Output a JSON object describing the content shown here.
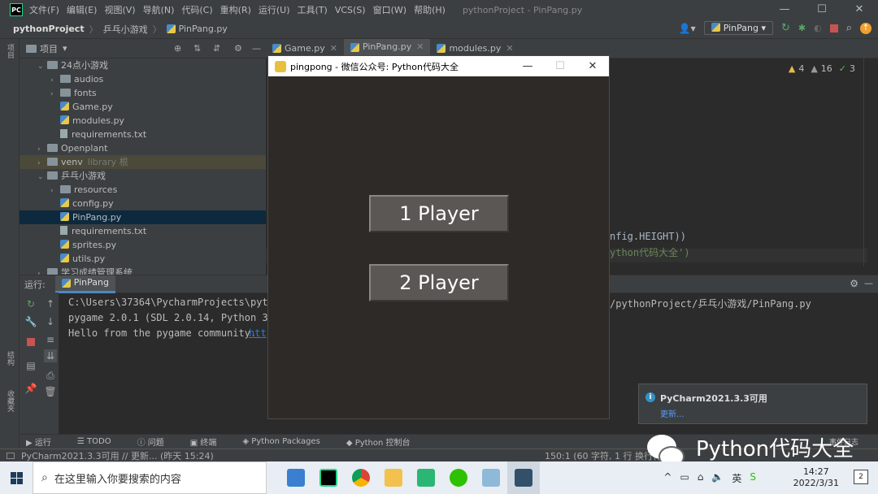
{
  "ide": {
    "menu": [
      "文件(F)",
      "编辑(E)",
      "视图(V)",
      "导航(N)",
      "代码(C)",
      "重构(R)",
      "运行(U)",
      "工具(T)",
      "VCS(S)",
      "窗口(W)",
      "帮助(H)"
    ],
    "window_title": "pythonProject - PinPang.py",
    "breadcrumb": [
      "pythonProject",
      "乒乓小游戏",
      "PinPang.py"
    ],
    "run_config": "PinPang",
    "project_panel_title": "项目",
    "tree": [
      {
        "label": "24点小游戏",
        "kind": "folder",
        "depth": 1,
        "open": true
      },
      {
        "label": "audios",
        "kind": "folder",
        "depth": 2,
        "open": false
      },
      {
        "label": "fonts",
        "kind": "folder",
        "depth": 2,
        "open": false
      },
      {
        "label": "Game.py",
        "kind": "py",
        "depth": 2
      },
      {
        "label": "modules.py",
        "kind": "py",
        "depth": 2
      },
      {
        "label": "requirements.txt",
        "kind": "txt",
        "depth": 2
      },
      {
        "label": "Openplant",
        "kind": "folder",
        "depth": 1,
        "open": false
      },
      {
        "label": "venv",
        "kind": "folder",
        "depth": 1,
        "open": false,
        "suffix": "library 根"
      },
      {
        "label": "乒乓小游戏",
        "kind": "folder",
        "depth": 1,
        "open": true
      },
      {
        "label": "resources",
        "kind": "folder",
        "depth": 2,
        "open": false
      },
      {
        "label": "config.py",
        "kind": "py",
        "depth": 2
      },
      {
        "label": "PinPang.py",
        "kind": "py",
        "depth": 2,
        "selected": true
      },
      {
        "label": "requirements.txt",
        "kind": "txt",
        "depth": 2
      },
      {
        "label": "sprites.py",
        "kind": "py",
        "depth": 2
      },
      {
        "label": "utils.py",
        "kind": "py",
        "depth": 2
      },
      {
        "label": "学习成绩管理系统",
        "kind": "folder",
        "depth": 1,
        "open": false
      }
    ],
    "editor_tabs": [
      {
        "label": "Game.py",
        "active": false
      },
      {
        "label": "PinPang.py",
        "active": true
      },
      {
        "label": "modules.py",
        "active": false
      }
    ],
    "inspections": {
      "warnings": "4",
      "weak": "16",
      "ok": "3"
    },
    "code_fragments": [
      "nfig.HEIGHT))",
      "ython代码大全')"
    ],
    "run_label": "运行:",
    "run_tab": "PinPang",
    "console": {
      "line1": "C:\\Users\\37364\\PycharmProjects\\pytho",
      "line1_tail": "/pythonProject/乒乓小游戏/PinPang.py",
      "line2": "pygame 2.0.1 (SDL 2.0.14, Python 3.8",
      "line3": "Hello from the pygame community. ",
      "line3_link": "htt"
    },
    "bottom_tabs": [
      "运行",
      "TODO",
      "问题",
      "终端",
      "Python Packages",
      "Python 控制台"
    ],
    "event_log": "事件日志",
    "status_left": "PyCharm2021.3.3可用 // 更新... (昨天 15:24)",
    "status_right": "150:1 (60 字符, 1 行 换行符)",
    "left_strip_labels": [
      "项目",
      "结构",
      "收藏夹"
    ],
    "notification": {
      "title": "PyCharm2021.3.3可用",
      "link": "更新..."
    }
  },
  "pygame_window": {
    "title": "pingpong - 微信公众号: Python代码大全",
    "buttons": [
      "1 Player",
      "2 Player"
    ]
  },
  "watermark": "Python代码大全",
  "taskbar": {
    "search_placeholder": "在这里输入你要搜索的内容",
    "time": "14:27",
    "date": "2022/3/31",
    "notify_count": "2"
  },
  "colors": {
    "ide_bg": "#2b2b2b",
    "panel_bg": "#3c3f41",
    "accent": "#4a88c7",
    "pygame_bg": "#2d2a27",
    "button_bg": "#5b5754"
  }
}
